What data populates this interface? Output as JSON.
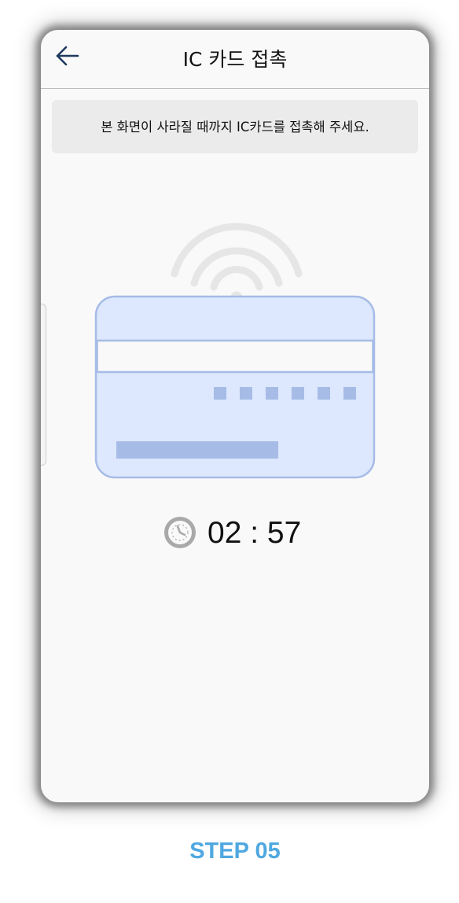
{
  "header": {
    "title": "IC 카드 접촉",
    "back_icon": "arrow-left-icon"
  },
  "notice": {
    "text": "본 화면이 사라질 때까지 IC카드를 접촉해 주세요."
  },
  "illustration": {
    "signal_icon": "wireless-signal-icon",
    "card_icon": "ic-card-icon"
  },
  "timer": {
    "icon": "clock-icon",
    "remaining": "02 : 57"
  },
  "step": {
    "label": "STEP 05"
  },
  "colors": {
    "card_fill": "#dde7fd",
    "card_stroke": "#a6bce6",
    "card_detail": "#a6bce6",
    "signal": "#e6e6e6",
    "clock": "#a9a9a9",
    "step_label": "#4fa8e0",
    "header_icon": "#1f3a5f"
  }
}
